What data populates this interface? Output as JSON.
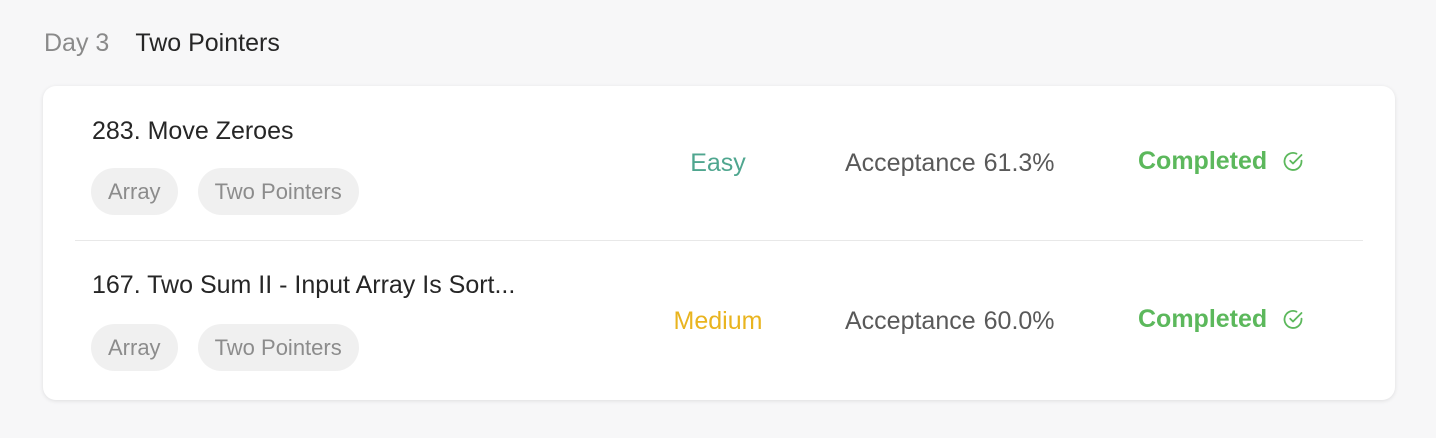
{
  "day": {
    "label": "Day 3",
    "topic": "Two Pointers"
  },
  "problems": [
    {
      "title": "283. Move Zeroes",
      "tags": [
        "Array",
        "Two Pointers"
      ],
      "difficulty": "Easy",
      "difficulty_color": "#4fa68f",
      "acceptance_label": "Acceptance",
      "acceptance_value": "61.3%",
      "status": "Completed",
      "status_color": "#5cb85c",
      "status_icon": "circle-check-icon"
    },
    {
      "title": "167. Two Sum II - Input Array Is Sort...",
      "tags": [
        "Array",
        "Two Pointers"
      ],
      "difficulty": "Medium",
      "difficulty_color": "#e9b41f",
      "acceptance_label": "Acceptance",
      "acceptance_value": "60.0%",
      "status": "Completed",
      "status_color": "#5cb85c",
      "status_icon": "circle-check-icon"
    }
  ]
}
